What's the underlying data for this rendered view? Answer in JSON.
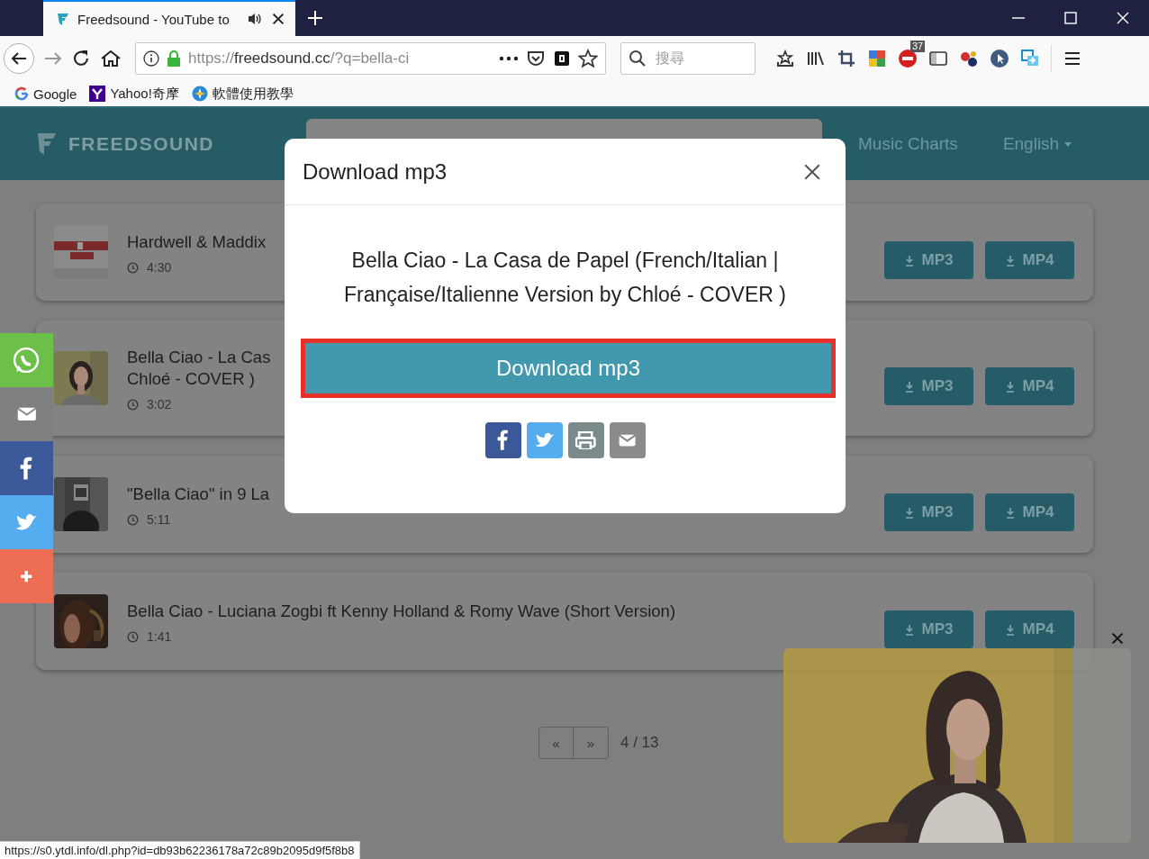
{
  "browser": {
    "tab": {
      "title": "Freedsound - YouTube to",
      "audio_playing": true
    },
    "url": "https://**freedsound.cc**/?q=bella-ci",
    "search": {
      "placeholder": "搜尋"
    },
    "extension_badge": "37",
    "bookmarks": [
      {
        "label": "Google",
        "kind": "google"
      },
      {
        "label": "Yahoo!奇摩",
        "kind": "yahoo"
      },
      {
        "label": "軟體使用教學",
        "kind": "compass"
      }
    ]
  },
  "site": {
    "brand": "FREEDSOUND",
    "nav": [
      {
        "label": "Music Charts",
        "dropdown": false
      },
      {
        "label": "English",
        "dropdown": true
      }
    ],
    "results": [
      {
        "title": [
          "Hardwell & Maddix"
        ],
        "duration": "4:30",
        "buttons": [
          "MP3",
          "MP4"
        ]
      },
      {
        "title": [
          "Bella Ciao - La Cas",
          "Chloé - COVER )"
        ],
        "duration": "3:02",
        "buttons": [
          "MP3",
          "MP4"
        ]
      },
      {
        "title": [
          "\"Bella Ciao\" in 9 La"
        ],
        "duration": "5:11",
        "buttons": [
          "MP3",
          "MP4"
        ]
      },
      {
        "title": [
          "Bella Ciao - Luciana Zogbi ft Kenny Holland & Romy Wave (Short Version)"
        ],
        "duration": "1:41",
        "buttons": [
          "MP3",
          "MP4"
        ]
      }
    ],
    "pagination": {
      "prev": "«",
      "next": "»",
      "page": "4 / 13"
    }
  },
  "share_bar": [
    {
      "kind": "whatsapp",
      "color": "#6cc04a"
    },
    {
      "kind": "email",
      "color": "#7f7f7f"
    },
    {
      "kind": "facebook",
      "color": "#3b5998"
    },
    {
      "kind": "twitter",
      "color": "#55acee"
    },
    {
      "kind": "plus",
      "color": "#ee6e55"
    }
  ],
  "modal": {
    "title": "Download mp3",
    "song": "Bella Ciao - La Casa de Papel (French/Italian | Française/Italienne Version by Chloé - COVER )",
    "button": "Download mp3",
    "highlighted": true,
    "share": [
      {
        "kind": "facebook"
      },
      {
        "kind": "twitter"
      },
      {
        "kind": "print"
      },
      {
        "kind": "email"
      }
    ]
  },
  "status_bar": {
    "url": "https://s0.ytdl.info/dl.php?id=db93b62236178a72c89b2095d9f5f8b8"
  }
}
